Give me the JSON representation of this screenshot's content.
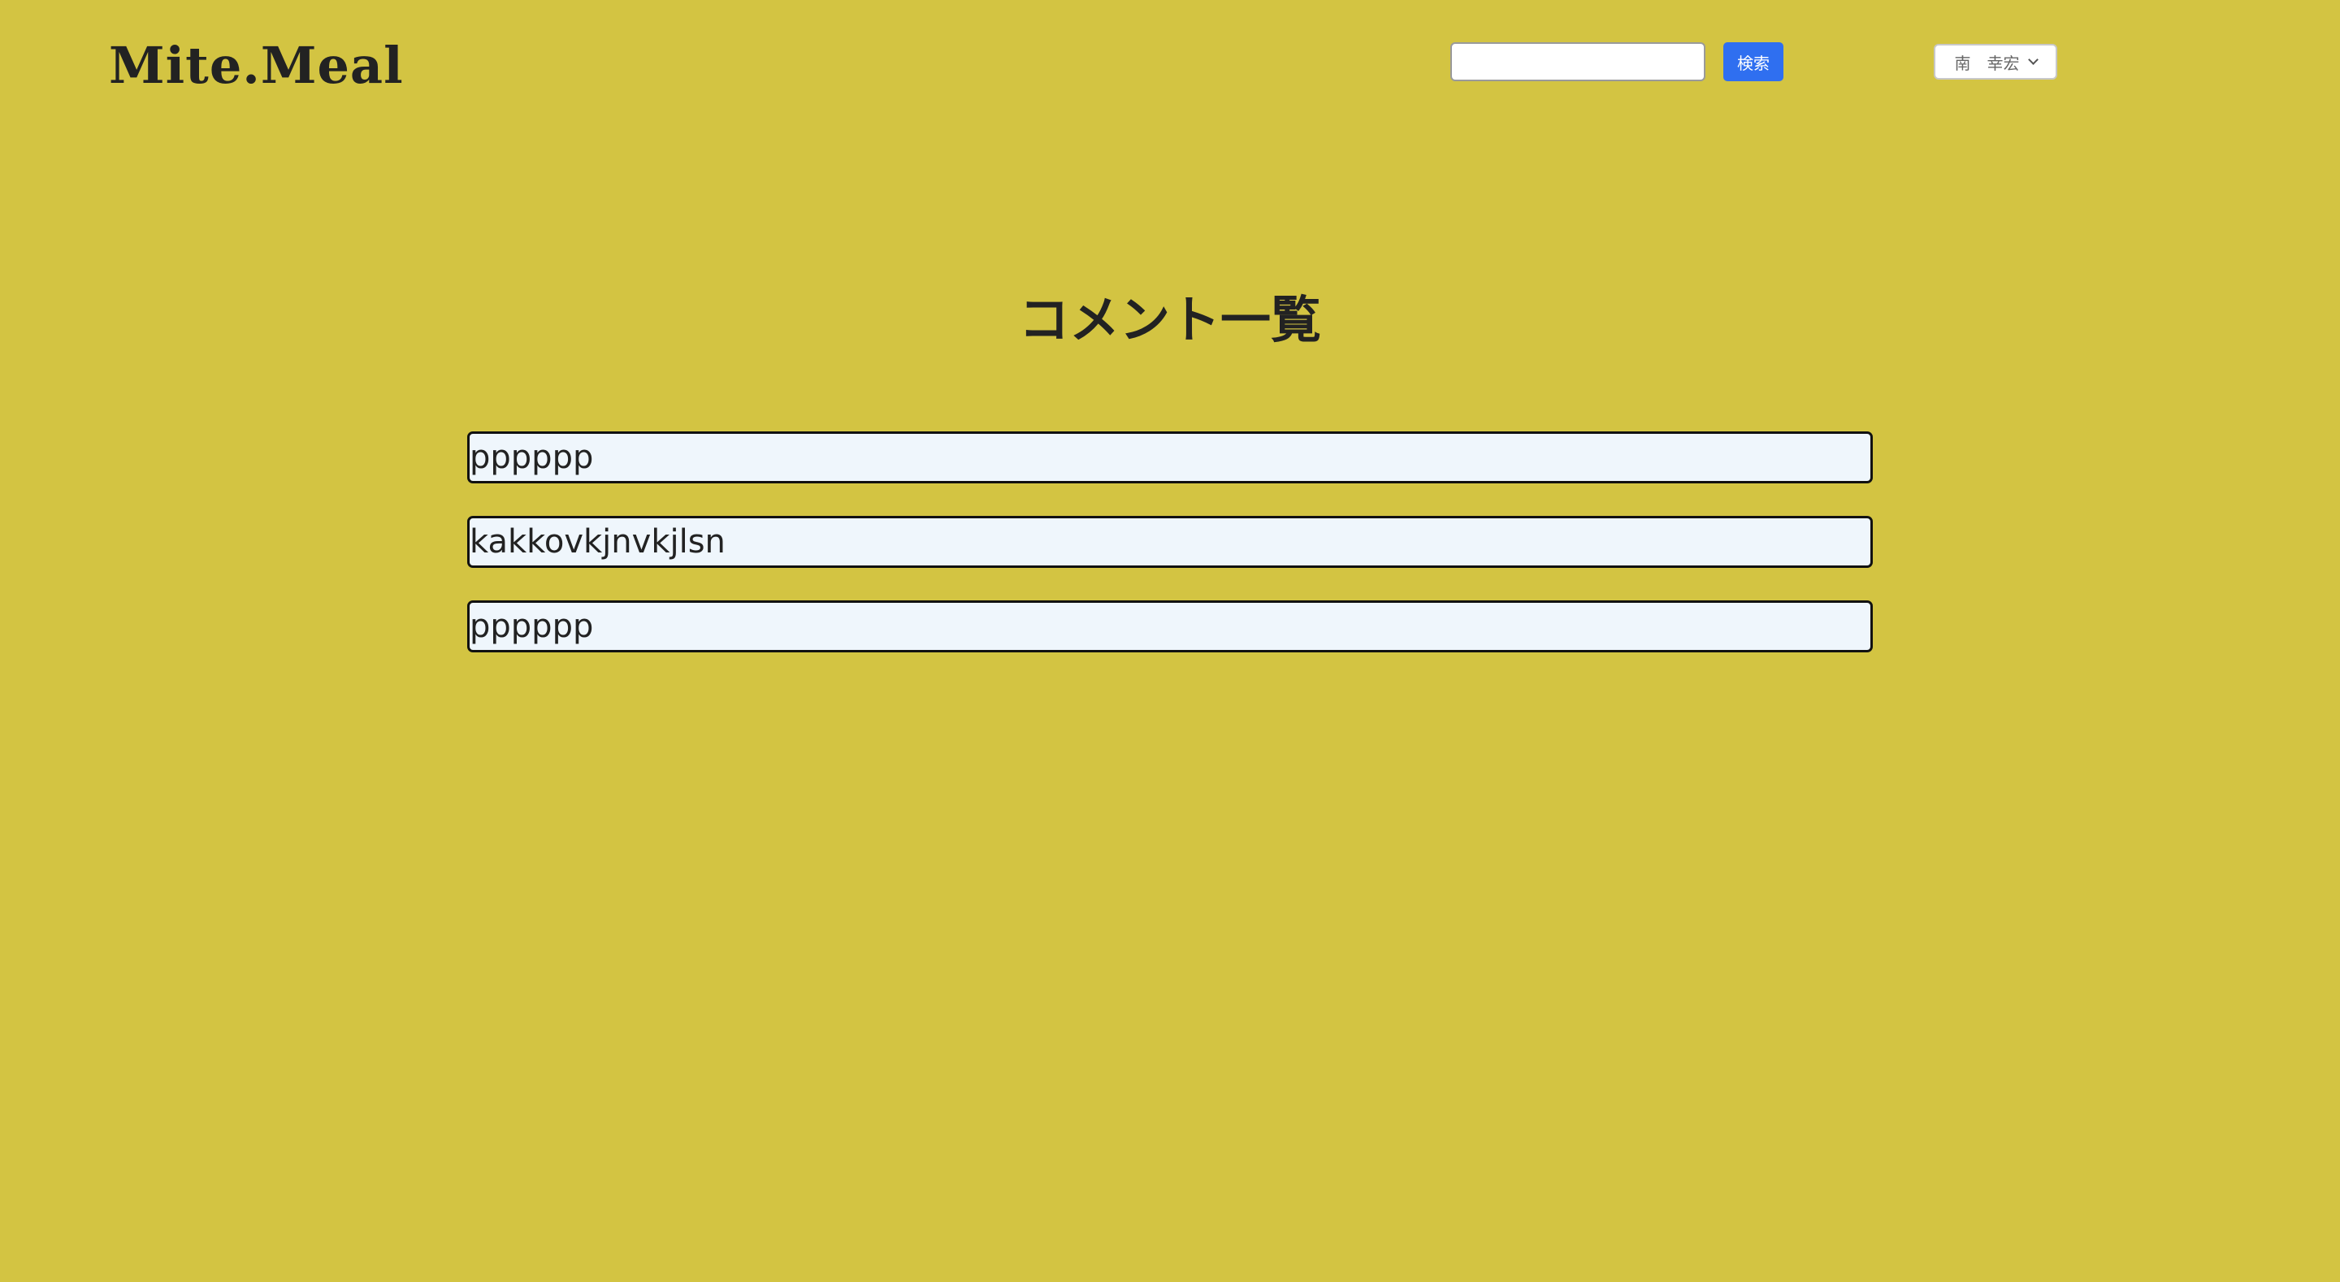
{
  "header": {
    "logo_text": "Mite.Meal",
    "search": {
      "value": "",
      "placeholder": "",
      "button_label": "検索"
    },
    "user_menu": {
      "label": "南　幸宏",
      "icon": "chevron-down-icon"
    }
  },
  "main": {
    "title": "コメント一覧",
    "comments": [
      {
        "text": "pppppp"
      },
      {
        "text": "kakkovkjnvkjlsn"
      },
      {
        "text": "pppppp"
      }
    ]
  },
  "colors": {
    "background": "#D3C442",
    "search_button": "#2F6FF0",
    "comment_background": "#EFF6FC",
    "comment_border": "#111111",
    "text": "#222222"
  }
}
